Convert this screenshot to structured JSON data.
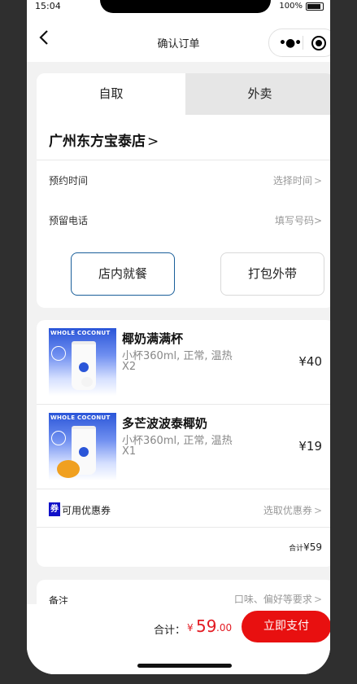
{
  "status_bar": {
    "time": "15:04",
    "battery": "100%"
  },
  "nav": {
    "title": "确认订单"
  },
  "order_mode": {
    "tabs": [
      {
        "label": "自取",
        "active": true
      },
      {
        "label": "外卖",
        "active": false
      }
    ],
    "store_name": "广州东方宝泰店",
    "store_chevron": ">",
    "rows": [
      {
        "label": "预约时间",
        "value": "选择时间",
        "chevron": ">"
      },
      {
        "label": "预留电话",
        "value": "填写号码>"
      }
    ],
    "dining_options": [
      {
        "label": "店内就餐",
        "selected": true
      },
      {
        "label": "打包外带",
        "selected": false
      }
    ]
  },
  "items": [
    {
      "name": "椰奶满满杯",
      "spec": "小杯360ml, 正常, 温热",
      "qty": "X2",
      "price": "¥40",
      "image_brand": "WHOLE COCONUT"
    },
    {
      "name": "多芒波波泰椰奶",
      "spec": "小杯360ml, 正常, 温热",
      "qty": "X1",
      "price": "¥19",
      "image_brand": "WHOLE COCONUT"
    }
  ],
  "coupon": {
    "icon_text": "券",
    "label": "可用优惠券",
    "value": "选取优惠券",
    "chevron": ">"
  },
  "subtotal": {
    "label": "合计",
    "amount": "¥59"
  },
  "remark": {
    "label": "备注",
    "placeholder": "口味、偏好等要求",
    "chevron": ">"
  },
  "footer": {
    "total_label": "合计：",
    "currency": "¥",
    "total_int": "59",
    "total_dec": ".00",
    "pay_button": "立即支付"
  },
  "colors": {
    "accent_red": "#e81010",
    "selected_border": "#1a5f9a",
    "coupon_blue": "#1010c8"
  }
}
